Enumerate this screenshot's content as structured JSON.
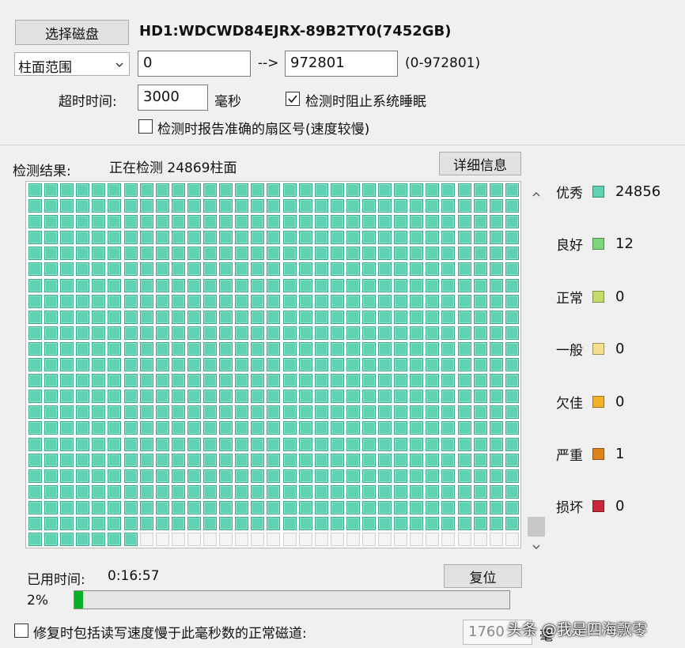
{
  "disk": {
    "select_button": "选择磁盘",
    "name": "HD1:WDCWD84EJRX-89B2TY0(7452GB)"
  },
  "range": {
    "mode": "柱面范围",
    "start": "0",
    "arrow": "-->",
    "end": "972801",
    "limit": "(0-972801)"
  },
  "timeout": {
    "label": "超时时间:",
    "value": "3000",
    "unit": "毫秒"
  },
  "options": {
    "prevent_sleep": {
      "label": "检测时阻止系统睡眠",
      "checked": true
    },
    "report_sector": {
      "label": "检测时报告准确的扇区号(速度较慢)",
      "checked": false
    }
  },
  "results": {
    "label": "检测结果:",
    "status": "正在检测 24869柱面",
    "detail_button": "详细信息"
  },
  "grid": {
    "columns": 31,
    "rows": 23,
    "scanned_cells": 7,
    "scanned_color": "#5fd2b3"
  },
  "legend": [
    {
      "name": "优秀",
      "color": "#5fd2b3",
      "count": "24856"
    },
    {
      "name": "良好",
      "color": "#7fd67a",
      "count": "12"
    },
    {
      "name": "正常",
      "color": "#c5dc6a",
      "count": "0"
    },
    {
      "name": "一般",
      "color": "#f4e08c",
      "count": "0"
    },
    {
      "name": "欠佳",
      "color": "#f5b12a",
      "count": "0"
    },
    {
      "name": "严重",
      "color": "#e0821a",
      "count": "1"
    },
    {
      "name": "损坏",
      "color": "#c8283a",
      "count": "0"
    }
  ],
  "elapsed": {
    "label": "已用时间:",
    "value": "0:16:57",
    "reset_button": "复位"
  },
  "progress": {
    "text": "2%",
    "value": 0.02
  },
  "repair": {
    "label": "修复时包括读写速度慢于此毫秒数的正常磁道:",
    "value": "1760",
    "unit": "毫"
  },
  "watermark": "头条 @我是四海飘零"
}
